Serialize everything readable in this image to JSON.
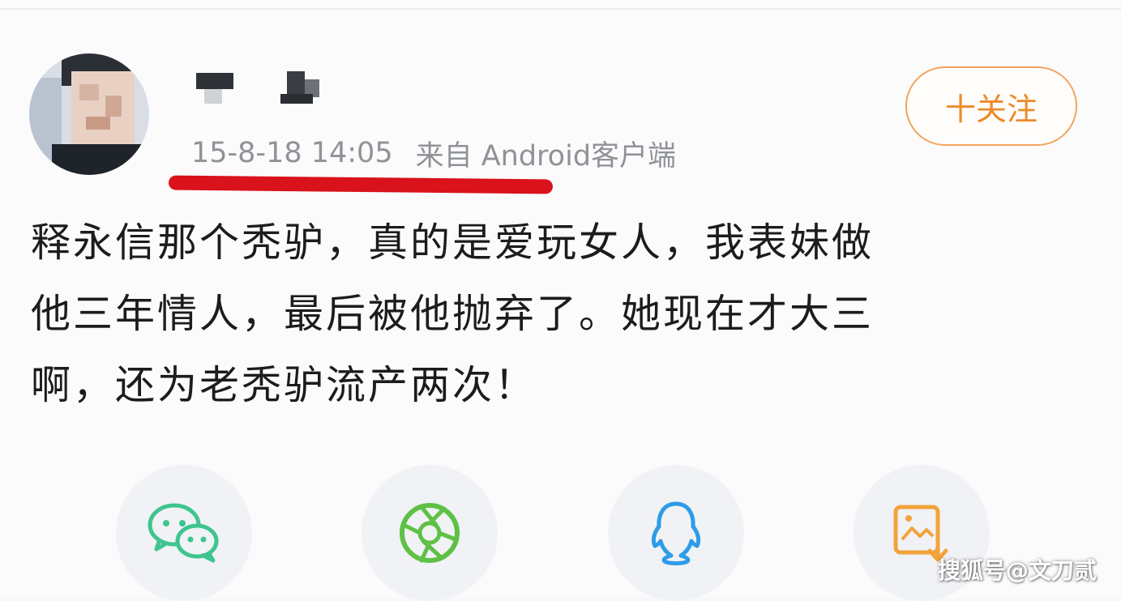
{
  "post": {
    "timestamp": "15-8-18 14:05",
    "source": "来自 Android客户端",
    "follow_label": "十关注",
    "text_lines": [
      "释永信那个秃驴，真的是爱玩女人，我表妹做",
      "他三年情人，最后被他抛弃了。她现在才大三",
      "啊，还为老秃驴流产两次！"
    ],
    "annotation_color": "#d9121b",
    "accent_color": "#ee8a28"
  },
  "share": {
    "icons": [
      "wechat-icon",
      "moments-icon",
      "qq-icon",
      "save-image-icon"
    ]
  },
  "watermark": "搜狐号@文刀贰"
}
